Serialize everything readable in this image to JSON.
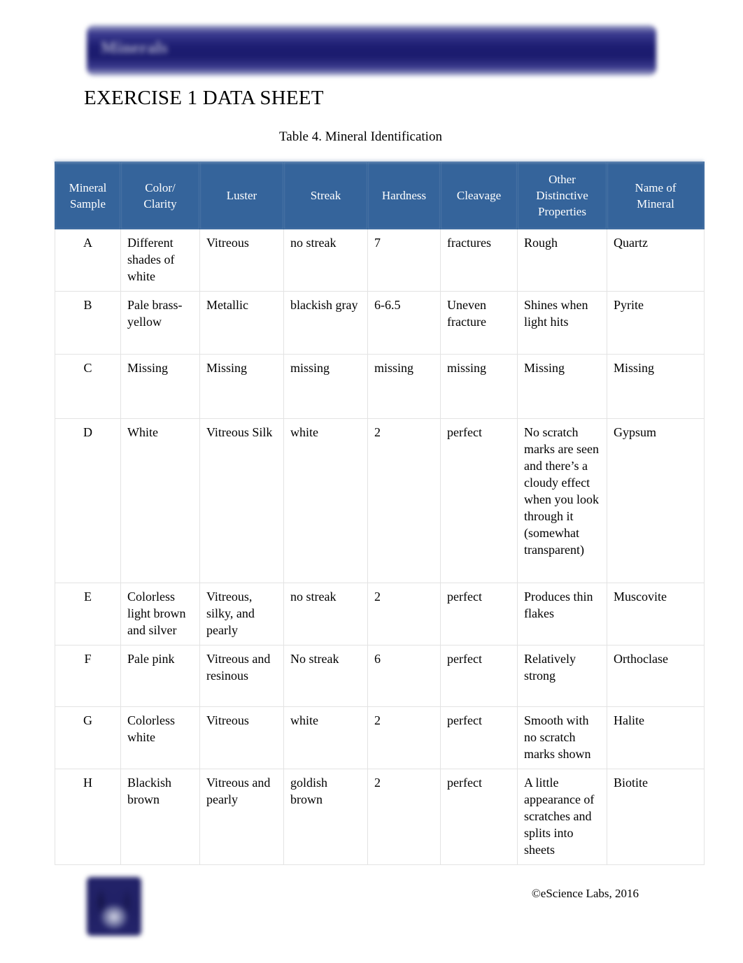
{
  "banner": {
    "title": "Minerals",
    "logo_icon": "minerals-banner-logo"
  },
  "document": {
    "title": "EXERCISE 1 DATA SHEET",
    "table_caption": "Table 4. Mineral Identification"
  },
  "table": {
    "headers": [
      "Mineral Sample",
      "Color/ Clarity",
      "Luster",
      "Streak",
      "Hardness",
      "Cleavage",
      "Other Distinctive Properties",
      "Name of Mineral"
    ],
    "header_lines": {
      "sample": [
        "Mineral",
        "Sample"
      ],
      "color": [
        "Color/",
        "Clarity"
      ],
      "luster": [
        "Luster"
      ],
      "streak": [
        "Streak"
      ],
      "hardness": [
        "Hardness"
      ],
      "cleavage": [
        "Cleavage"
      ],
      "other": [
        "Other",
        "Distinctive",
        "Properties"
      ],
      "name": [
        "Name of",
        "Mineral"
      ]
    },
    "rows": [
      {
        "sample": "A",
        "color": "Different shades of white",
        "luster": "Vitreous",
        "streak": "no streak",
        "hardness": "7",
        "cleavage": "fractures",
        "other": "Rough",
        "name": "Quartz"
      },
      {
        "sample": "B",
        "color": "Pale brass-yellow",
        "luster": "Metallic",
        "streak": "blackish gray",
        "hardness": "6-6.5",
        "cleavage": "Uneven fracture",
        "other": "Shines when light hits",
        "name": "Pyrite"
      },
      {
        "sample": "C",
        "color": "Missing",
        "luster": "Missing",
        "streak": "missing",
        "hardness": "missing",
        "cleavage": "missing",
        "other": "Missing",
        "name": "Missing"
      },
      {
        "sample": "D",
        "color": "White",
        "luster": "Vitreous Silk",
        "streak": "white",
        "hardness": "2",
        "cleavage": "perfect",
        "other": "No scratch marks are seen and there’s a cloudy effect when you look through it (somewhat transparent)",
        "name": "Gypsum"
      },
      {
        "sample": "E",
        "color": "Colorless light brown and silver",
        "luster": "Vitreous, silky, and pearly",
        "streak": "no streak",
        "hardness": "2",
        "cleavage": "perfect",
        "other": "Produces thin flakes",
        "name": "Muscovite"
      },
      {
        "sample": "F",
        "color": "Pale pink",
        "luster": "Vitreous and resinous",
        "streak": "No streak",
        "hardness": "6",
        "cleavage": "perfect",
        "other": "Relatively strong",
        "name": "Orthoclase"
      },
      {
        "sample": "G",
        "color": "Colorless white",
        "luster": "Vitreous",
        "streak": "white",
        "hardness": "2",
        "cleavage": "perfect",
        "other": "Smooth with no scratch marks shown",
        "name": "Halite"
      },
      {
        "sample": "H",
        "color": "Blackish brown",
        "luster": "Vitreous and pearly",
        "streak": "goldish brown",
        "hardness": "2",
        "cleavage": "perfect",
        "other": "A little appearance of scratches and splits into sheets",
        "name": "Biotite"
      }
    ]
  },
  "footer": {
    "credit": "©eScience Labs, 2016",
    "logo_icon": "escience-labs-logo"
  },
  "colors": {
    "banner_navy": "#1d1d72",
    "table_header_blue": "#35649b",
    "grid_line": "#e3e3e3",
    "text": "#000000"
  }
}
